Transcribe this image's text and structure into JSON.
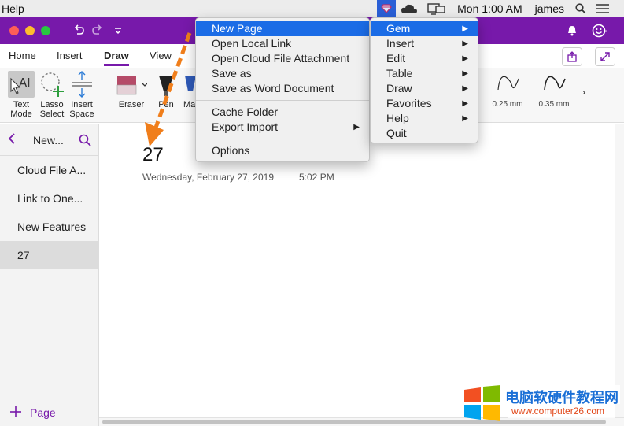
{
  "menubar": {
    "help_label": "Help",
    "clock": "Mon 1:00 AM",
    "user": "james"
  },
  "tabs": [
    {
      "label": "Home"
    },
    {
      "label": "Insert"
    },
    {
      "label": "Draw"
    },
    {
      "label": "View"
    }
  ],
  "ribbon": {
    "text_mode": [
      "Text",
      "Mode"
    ],
    "lasso_select": [
      "Lasso",
      "Select"
    ],
    "insert_space": [
      "Insert",
      "Space"
    ],
    "eraser": "Eraser",
    "pen": "Pen",
    "marker": "Ma",
    "pen_sizes": [
      "0.25 mm",
      "0.35 mm"
    ]
  },
  "sidebar": {
    "section": "New...",
    "pages": [
      "Cloud File A...",
      "Link to One...",
      "New Features",
      "27"
    ],
    "add_page_label": "Page"
  },
  "page": {
    "title": "27",
    "date": "Wednesday, February 27, 2019",
    "time": "5:02 PM"
  },
  "main_menu": {
    "items": [
      "New Page",
      "Open Local Link",
      "Open Cloud File Attachment",
      "Save as",
      "Save as Word Document",
      "Cache Folder",
      "Export Import",
      "Options"
    ]
  },
  "gem_menu": {
    "items": [
      "Gem",
      "Insert",
      "Edit",
      "Table",
      "Draw",
      "Favorites",
      "Help",
      "Quit"
    ]
  },
  "watermark": {
    "name": "电脑软硬件教程网",
    "url": "www.computer26.com"
  },
  "colors": {
    "accent": "#7719aa",
    "menu_highlight": "#1b6ce6",
    "annotation": "#f07e1b"
  }
}
